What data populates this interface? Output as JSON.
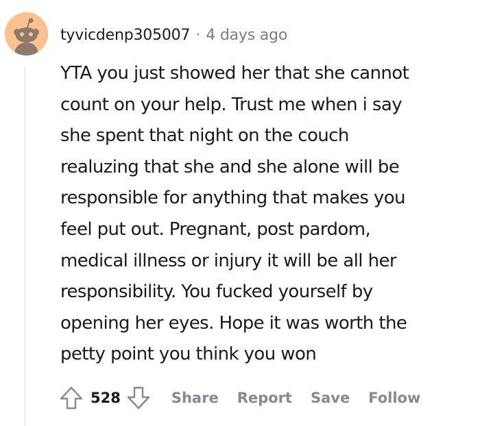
{
  "comment": {
    "author": "tyvicdenp305007",
    "separator": "·",
    "timestamp": "4 days ago",
    "avatar_icon": "snoo-avatar-icon",
    "avatar_color": "#fbc18e",
    "body_lines": [
      "YTA you just showed her that she cannot",
      "count on your help. Trust me when i say",
      "she spent that night on the couch",
      "realuzing that she and she alone will be",
      "responsible for anything that makes you",
      "feel put out. Pregnant, post pardom,",
      "medical illness or injury it will be all her",
      "responsibility. You fucked yourself by",
      "opening her eyes. Hope it was worth the",
      "petty point you think you won"
    ],
    "score": "528",
    "actions": {
      "share": "Share",
      "report": "Report",
      "save": "Save",
      "follow": "Follow"
    }
  },
  "icons": {
    "upvote": "upvote-arrow-icon",
    "downvote": "downvote-arrow-icon"
  }
}
